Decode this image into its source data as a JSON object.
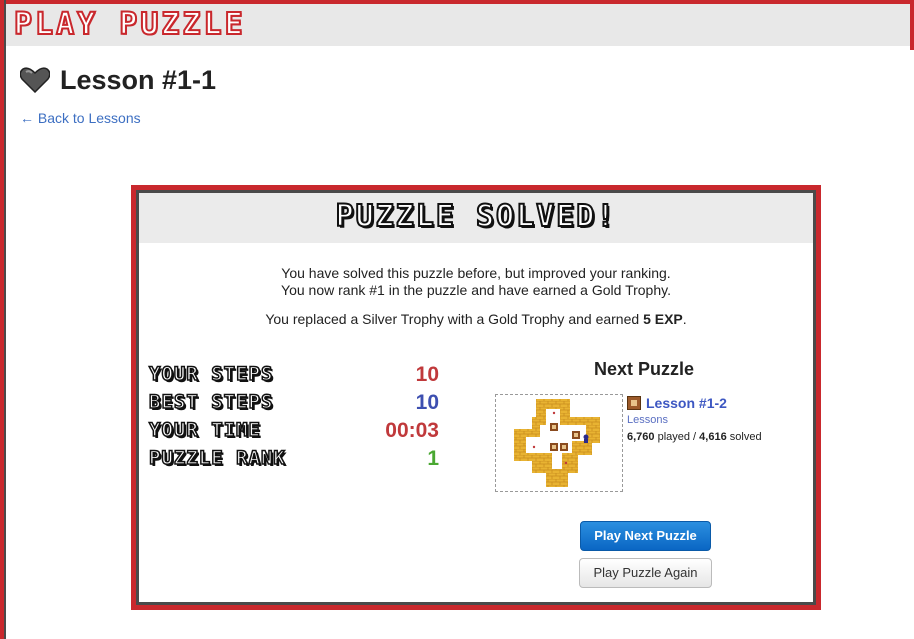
{
  "header": {
    "logo_text": "PLAY PUZZLE"
  },
  "page": {
    "title": "Lesson #1-1",
    "back_link": "← Back to Lessons"
  },
  "modal": {
    "title": "PUZZLE SOLVED!",
    "message_line1": "You have solved this puzzle before, but improved your ranking.",
    "message_line2": "You now rank #1 in the puzzle and have earned a Gold Trophy.",
    "message3_prefix": "You replaced a Silver Trophy with a Gold Trophy and earned ",
    "message3_bold": "5 EXP",
    "message3_suffix": ".",
    "stats": [
      {
        "label": "YOUR STEPS",
        "value": "10",
        "color": "#c0393b"
      },
      {
        "label": "BEST STEPS",
        "value": "10",
        "color": "#3d4fb0"
      },
      {
        "label": "YOUR TIME",
        "value": "00:03",
        "color": "#c0393b"
      },
      {
        "label": "PUZZLE RANK",
        "value": "1",
        "color": "#4aa832"
      }
    ],
    "next_puzzle": {
      "heading": "Next Puzzle",
      "name": "Lesson #1-2",
      "category": "Lessons",
      "played": "6,760",
      "played_label": " played / ",
      "solved": "4,616",
      "solved_label": " solved"
    },
    "buttons": {
      "play_next": "Play Next Puzzle",
      "play_again": "Play Puzzle Again"
    }
  },
  "colors": {
    "accent_red": "#c9282d",
    "link_blue": "#3d6fc2",
    "primary_button": "#0a66c4"
  },
  "icons": {
    "title_icon": "heart-icon",
    "puzzle_icon": "box-icon"
  }
}
